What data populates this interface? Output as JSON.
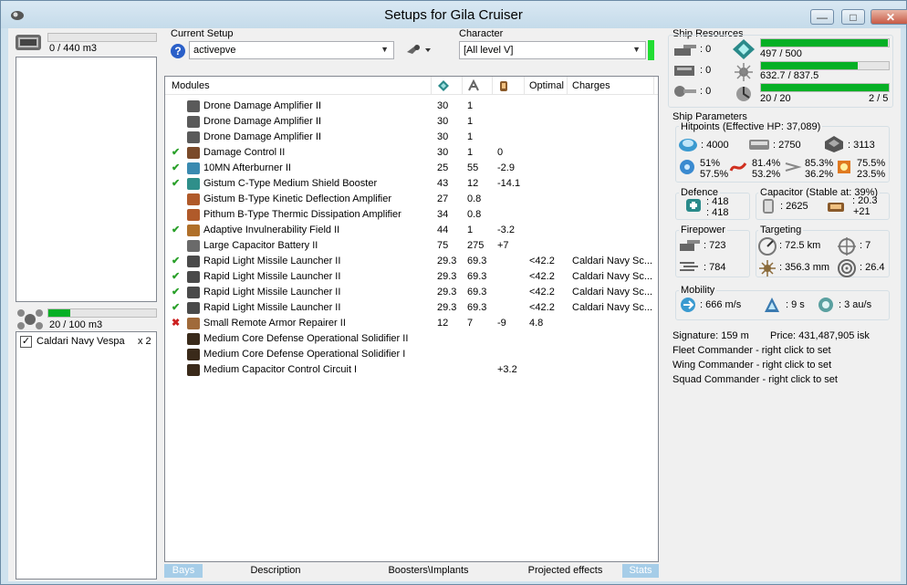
{
  "window": {
    "title": "Setups for Gila Cruiser"
  },
  "cargo": {
    "capacity": "0 / 440 m3",
    "fill": 0
  },
  "drones": {
    "capacity": "20 / 100 m3",
    "fill": 0.2,
    "items": [
      {
        "label": "Caldari Navy Vespa",
        "qty": "x 2",
        "checked": true
      }
    ]
  },
  "setup": {
    "label": "Current Setup",
    "value": "activepve"
  },
  "character": {
    "label": "Character",
    "value": "[All level V]"
  },
  "modules": {
    "headers": {
      "name": "Modules",
      "optimal": "Optimal",
      "charges": "Charges"
    },
    "rows": [
      {
        "status": "",
        "name": "Drone Damage Amplifier II",
        "cpu": "30",
        "pg": "1",
        "cap": "",
        "optimal": "",
        "charges": "",
        "color": "#5a5a5a"
      },
      {
        "status": "",
        "name": "Drone Damage Amplifier II",
        "cpu": "30",
        "pg": "1",
        "cap": "",
        "optimal": "",
        "charges": "",
        "color": "#5a5a5a"
      },
      {
        "status": "",
        "name": "Drone Damage Amplifier II",
        "cpu": "30",
        "pg": "1",
        "cap": "",
        "optimal": "",
        "charges": "",
        "color": "#5a5a5a"
      },
      {
        "status": "✔",
        "name": "Damage Control II",
        "cpu": "30",
        "pg": "1",
        "cap": "0",
        "optimal": "",
        "charges": "",
        "color": "#7a4a2a"
      },
      {
        "status": "✔",
        "name": "10MN Afterburner II",
        "cpu": "25",
        "pg": "55",
        "cap": "-2.9",
        "optimal": "",
        "charges": "",
        "color": "#3a8ab0"
      },
      {
        "status": "✔",
        "name": "Gistum C-Type Medium Shield Booster",
        "cpu": "43",
        "pg": "12",
        "cap": "-14.1",
        "optimal": "",
        "charges": "",
        "color": "#2f8f8a"
      },
      {
        "status": "",
        "name": "Gistum B-Type Kinetic Deflection Amplifier",
        "cpu": "27",
        "pg": "0.8",
        "cap": "",
        "optimal": "",
        "charges": "",
        "color": "#b05a2a"
      },
      {
        "status": "",
        "name": "Pithum B-Type Thermic Dissipation Amplifier",
        "cpu": "34",
        "pg": "0.8",
        "cap": "",
        "optimal": "",
        "charges": "",
        "color": "#b05a2a"
      },
      {
        "status": "✔",
        "name": "Adaptive Invulnerability Field II",
        "cpu": "44",
        "pg": "1",
        "cap": "-3.2",
        "optimal": "",
        "charges": "",
        "color": "#b0702a"
      },
      {
        "status": "",
        "name": "Large Capacitor Battery II",
        "cpu": "75",
        "pg": "275",
        "cap": "+7",
        "optimal": "",
        "charges": "",
        "color": "#6a6a6a"
      },
      {
        "status": "✔",
        "name": "Rapid Light Missile Launcher II",
        "cpu": "29.3",
        "pg": "69.3",
        "cap": "",
        "optimal": "<42.2",
        "charges": "Caldari Navy Sc...",
        "color": "#4a4a4a"
      },
      {
        "status": "✔",
        "name": "Rapid Light Missile Launcher II",
        "cpu": "29.3",
        "pg": "69.3",
        "cap": "",
        "optimal": "<42.2",
        "charges": "Caldari Navy Sc...",
        "color": "#4a4a4a"
      },
      {
        "status": "✔",
        "name": "Rapid Light Missile Launcher II",
        "cpu": "29.3",
        "pg": "69.3",
        "cap": "",
        "optimal": "<42.2",
        "charges": "Caldari Navy Sc...",
        "color": "#4a4a4a"
      },
      {
        "status": "✔",
        "name": "Rapid Light Missile Launcher II",
        "cpu": "29.3",
        "pg": "69.3",
        "cap": "",
        "optimal": "<42.2",
        "charges": "Caldari Navy Sc...",
        "color": "#4a4a4a"
      },
      {
        "status": "✖",
        "name": "Small Remote Armor Repairer II",
        "cpu": "12",
        "pg": "7",
        "cap": "-9",
        "optimal": "4.8",
        "charges": "",
        "color": "#a06a3a"
      },
      {
        "status": "",
        "name": "Medium Core Defense Operational Solidifier II",
        "cpu": "",
        "pg": "",
        "cap": "",
        "optimal": "",
        "charges": "",
        "color": "#3a2a1a"
      },
      {
        "status": "",
        "name": "Medium Core Defense Operational Solidifier I",
        "cpu": "",
        "pg": "",
        "cap": "",
        "optimal": "",
        "charges": "",
        "color": "#3a2a1a"
      },
      {
        "status": "",
        "name": "Medium Capacitor Control Circuit I",
        "cpu": "",
        "pg": "",
        "cap": "+3.2",
        "optimal": "",
        "charges": "",
        "color": "#3a2a1a"
      }
    ]
  },
  "tabs": [
    "Bays",
    "Description",
    "Boosters\\Implants",
    "Projected effects",
    "Stats"
  ],
  "resources": {
    "title": "Ship Resources",
    "hardpoints": [
      {
        "v": ": 0"
      },
      {
        "v": ": 0"
      },
      {
        "v": ": 0"
      }
    ],
    "cpu": {
      "text": "497 / 500",
      "fill": 0.994
    },
    "pg": {
      "text": "632.7 / 837.5",
      "fill": 0.755
    },
    "calib": {
      "text": "20 / 20",
      "rigs": "2 / 5",
      "fill": 1
    }
  },
  "params": {
    "title": "Ship Parameters",
    "hp_title": "Hitpoints (Effective HP: 37,089)",
    "hp": {
      "shield": ": 4000",
      "armor": ": 2750",
      "hull": ": 3113"
    },
    "res": [
      [
        "51%",
        "57.5%"
      ],
      [
        "81.4%",
        "53.2%"
      ],
      [
        "85.3%",
        "36.2%"
      ],
      [
        "75.5%",
        "23.5%"
      ]
    ],
    "defence": {
      "title": "Defence",
      "a": ": 418",
      "b": ": 418"
    },
    "capacitor": {
      "title": "Capacitor (Stable at: 39%)",
      "amount": ": 2625",
      "recharge": ": 20.3",
      "plus": "+21"
    },
    "firepower": {
      "title": "Firepower",
      "a": ": 723",
      "b": ": 784"
    },
    "targeting": {
      "title": "Targeting",
      "range": ": 72.5 km",
      "targets": ": 7",
      "scan": ": 356.3 mm",
      "sensor": ": 26.4"
    },
    "mobility": {
      "title": "Mobility",
      "speed": ": 666 m/s",
      "align": ": 9 s",
      "warp": ": 3 au/s"
    },
    "signature": "Signature: 159 m",
    "price": "Price: 431,487,905 isk",
    "fleet": "Fleet Commander - right click to set",
    "wing": "Wing Commander - right click to set",
    "squad": "Squad Commander - right click to set"
  }
}
